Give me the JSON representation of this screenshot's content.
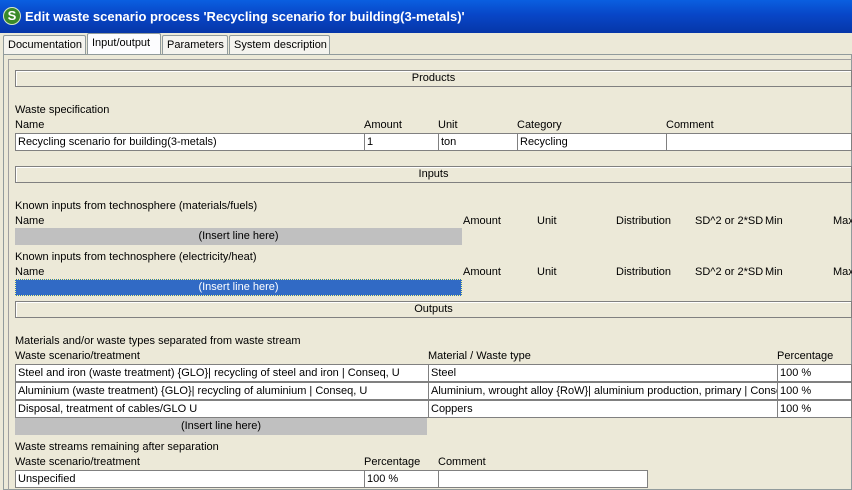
{
  "window": {
    "title": "Edit waste scenario process 'Recycling scenario for building(3-metals)'",
    "icon": "S"
  },
  "tabs": [
    "Documentation",
    "Input/output",
    "Parameters",
    "System description"
  ],
  "sections": {
    "products": "Products",
    "inputs": "Inputs",
    "outputs": "Outputs"
  },
  "waste_spec": {
    "label": "Waste specification",
    "headers": {
      "name": "Name",
      "amount": "Amount",
      "unit": "Unit",
      "category": "Category",
      "comment": "Comment"
    },
    "row": {
      "name": "Recycling scenario for building(3-metals)",
      "amount": "1",
      "unit": "ton",
      "category": "Recycling",
      "comment": ""
    }
  },
  "known_materials": {
    "label": "Known inputs from technosphere (materials/fuels)",
    "headers": {
      "name": "Name",
      "amount": "Amount",
      "unit": "Unit",
      "distribution": "Distribution",
      "sd": "SD^2 or 2*SD",
      "min": "Min",
      "max": "Max"
    },
    "insert": "(Insert line here)"
  },
  "known_electricity": {
    "label": "Known inputs from technosphere (electricity/heat)",
    "headers": {
      "name": "Name",
      "amount": "Amount",
      "unit": "Unit",
      "distribution": "Distribution",
      "sd": "SD^2 or 2*SD",
      "min": "Min",
      "max": "Max"
    },
    "insert": "(Insert line here)"
  },
  "separated": {
    "label": "Materials and/or waste types separated from waste stream",
    "headers": {
      "treatment": "Waste scenario/treatment",
      "material": "Material / Waste type",
      "percentage": "Percentage"
    },
    "rows": [
      {
        "treatment": "Steel and iron (waste treatment) {GLO}| recycling of steel and iron | Conseq, U",
        "material": "Steel",
        "percentage": "100 %"
      },
      {
        "treatment": "Aluminium (waste treatment) {GLO}| recycling of aluminium | Conseq, U",
        "material": "Aluminium, wrought alloy {RoW}| aluminium production, primary | Conse",
        "percentage": "100 %"
      },
      {
        "treatment": "Disposal, treatment of cables/GLO U",
        "material": "Coppers",
        "percentage": "100 %"
      }
    ],
    "insert": "(Insert line here)"
  },
  "remaining": {
    "label": "Waste streams remaining after separation",
    "headers": {
      "treatment": "Waste scenario/treatment",
      "percentage": "Percentage",
      "comment": "Comment"
    },
    "row": {
      "treatment": "Unspecified",
      "percentage": "100 %",
      "comment": ""
    }
  }
}
